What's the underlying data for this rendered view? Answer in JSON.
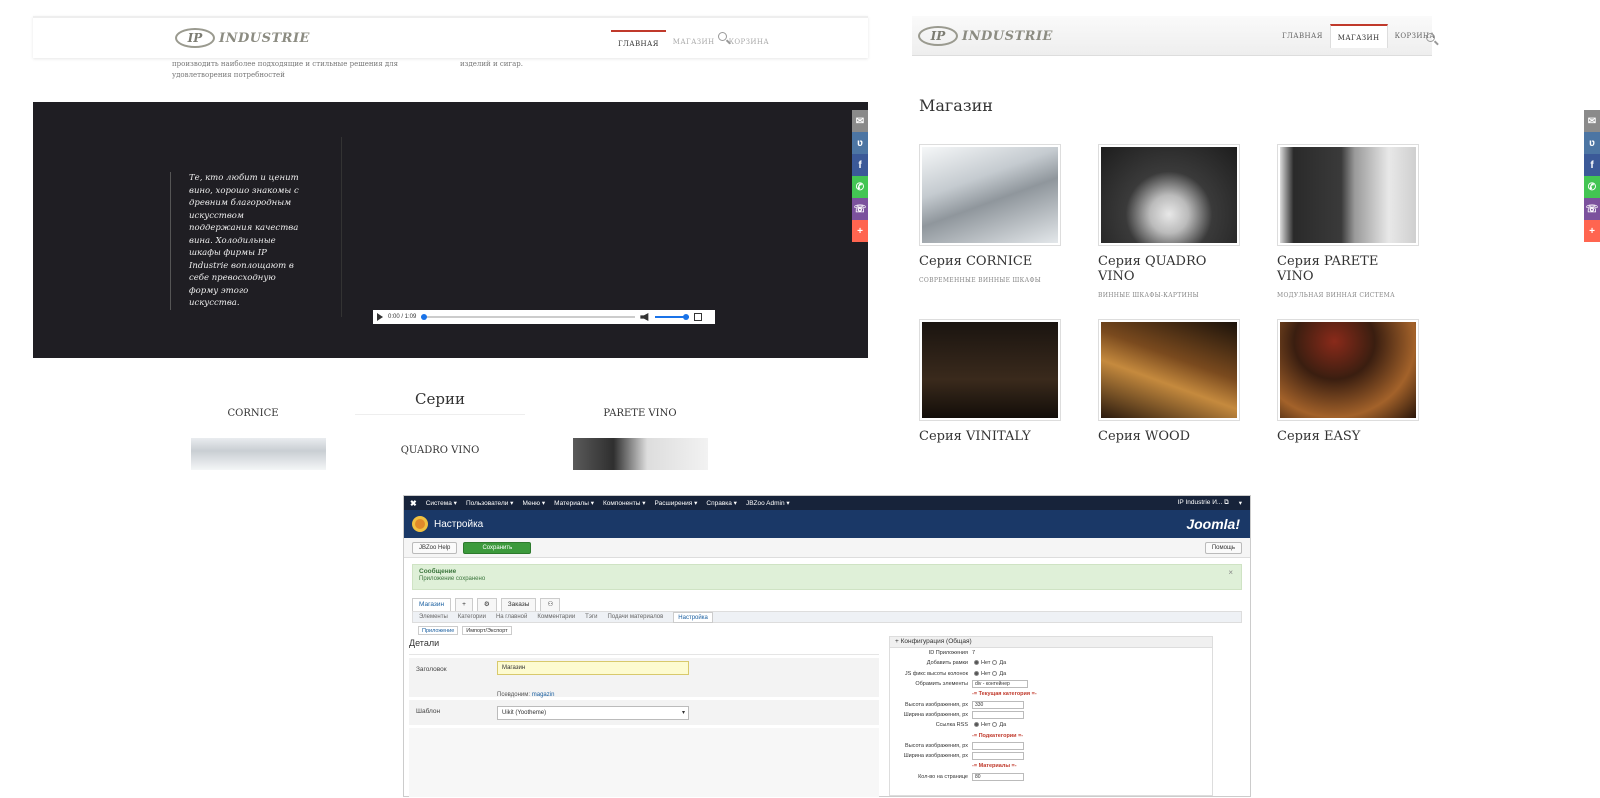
{
  "home": {
    "logo": {
      "mark": "IP",
      "word": "INDUSTRIE"
    },
    "nav": [
      "ГЛАВНАЯ",
      "МАГАЗИН",
      "КОРЗИНА"
    ],
    "intro_left": "высоких понятий заключается в том, чтобы разрабатывать и производить наиболее подходящие и стильные решения для удовлетворения потребностей",
    "intro_right": "вин, но и для выдерживания и хранения коньяков, алкогольных изделий и сигар.",
    "quote": "Те, кто любит и ценит вино, хорошо знакомы с древним благородным искусством поддержания качества вина. Холодильные шкафы фирмы IP Industrie воплощают в себе превосходную форму этого искусства.",
    "player": {
      "time": "0:00 / 1:09",
      "progress_fraction": 0.0,
      "volume_fraction": 1.0
    },
    "series_title": "Серии",
    "series": [
      "CORNICE",
      "QUADRO VINO",
      "PARETE VINO"
    ]
  },
  "share": {
    "icons": [
      "mail-icon",
      "vk-icon",
      "facebook-icon",
      "whatsapp-icon",
      "viber-icon",
      "more-icon"
    ],
    "glyphs": [
      "✉",
      "ʋ",
      "f",
      "✆",
      "☏",
      "+"
    ],
    "colors": [
      "#8a8a8a",
      "#4c75a3",
      "#3b5998",
      "#43c553",
      "#7b519d",
      "#ff6550"
    ]
  },
  "shop": {
    "logo": {
      "mark": "IP",
      "word": "INDUSTRIE"
    },
    "nav": [
      "ГЛАВНАЯ",
      "МАГАЗИН",
      "КОРЗИНА"
    ],
    "title": "Магазин",
    "products": [
      {
        "name": "Серия CORNICE",
        "sub": "СОВРЕМЕННЫЕ ВИННЫЕ ШКАФЫ"
      },
      {
        "name": "Серия QUADRO VINO",
        "sub": "ВИННЫЕ ШКАФЫ-КАРТИНЫ"
      },
      {
        "name": "Серия PARETE VINO",
        "sub": "МОДУЛЬНАЯ ВИННАЯ СИСТЕМА"
      },
      {
        "name": "Серия VINITALY",
        "sub": ""
      },
      {
        "name": "Серия WOOD",
        "sub": ""
      },
      {
        "name": "Серия EASY",
        "sub": ""
      }
    ]
  },
  "admin": {
    "menu": [
      "Система ▾",
      "Пользователи ▾",
      "Меню ▾",
      "Материалы ▾",
      "Компоненты ▾",
      "Расширения ▾",
      "Справка ▾",
      "JBZoo Admin ▾"
    ],
    "menu_right": [
      "IP Industrie И... ⧉",
      "▾"
    ],
    "header_title": "Настройка",
    "brand": "Joomla!",
    "toolbar": {
      "help_label": "JBZoo Help",
      "save_label": "Сохранить",
      "help_btn": "Помощь"
    },
    "alert": {
      "title": "Сообщение",
      "text": "Приложение сохранено"
    },
    "app_tabs": [
      "Магазин",
      "+",
      "⚙",
      "Заказы",
      "⚇"
    ],
    "sub_tabs": [
      "Элементы",
      "Категории",
      "На главной",
      "Комментарии",
      "Тэги",
      "Подачи материалов",
      "Настройка"
    ],
    "mini_tabs": [
      "Приложение",
      "Импорт/Экспорт"
    ],
    "details_title": "Детали",
    "fields": {
      "title_label": "Заголовок",
      "title_value": "Магазин",
      "alias_label": "Псевдоним:",
      "alias_value": "magazin",
      "template_label": "Шаблон",
      "template_value": "Uikit (Yootheme)"
    },
    "config": {
      "head": "Конфигурация (Общая)",
      "rows": [
        {
          "label": "ID Приложения",
          "value": "7",
          "kind": "text"
        },
        {
          "label": "Добавить рамки",
          "value": "Нет|Да",
          "kind": "radio"
        },
        {
          "label": "JS фикс высоты колонок",
          "value": "Нет|Да",
          "kind": "radio"
        },
        {
          "label": "Обрамить элементы",
          "value": "div - контейнер",
          "kind": "select"
        },
        {
          "label": "",
          "value": "-= Текущая категория =-",
          "kind": "section"
        },
        {
          "label": "Высота изображения, px",
          "value": "330",
          "kind": "input"
        },
        {
          "label": "Ширина изображения, px",
          "value": "",
          "kind": "input"
        },
        {
          "label": "Ссылка RSS",
          "value": "Нет|Да",
          "kind": "radio"
        },
        {
          "label": "",
          "value": "-= Подкатегории =-",
          "kind": "section"
        },
        {
          "label": "Высота изображения, px",
          "value": "",
          "kind": "input"
        },
        {
          "label": "Ширина изображения, px",
          "value": "",
          "kind": "input"
        },
        {
          "label": "",
          "value": "-= Материалы =-",
          "kind": "section"
        },
        {
          "label": "Кол-во на странице",
          "value": "80",
          "kind": "input"
        }
      ]
    }
  }
}
